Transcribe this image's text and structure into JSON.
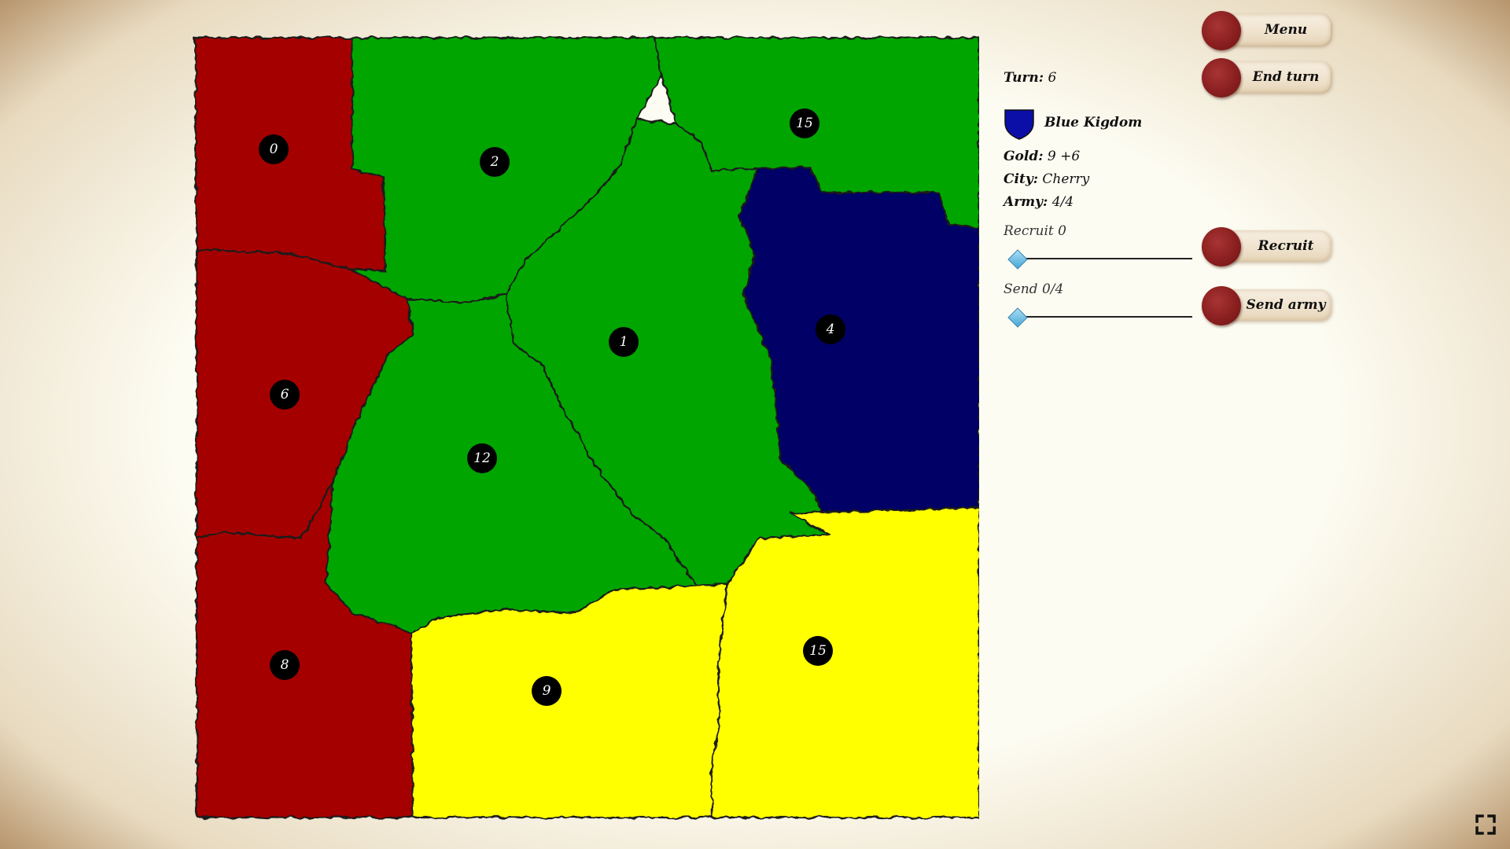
{
  "colors": {
    "red": "#a50000",
    "green": "#00a500",
    "blue": "#000066",
    "yellow": "#ffff00",
    "badge": "#000000",
    "seal": "#8a1f1f",
    "slider_thumb": "#5ab4e0"
  },
  "map": {
    "territories": [
      {
        "id": "t-red-1",
        "owner": "red",
        "army": "0"
      },
      {
        "id": "t-red-2",
        "owner": "red",
        "army": "6"
      },
      {
        "id": "t-red-3",
        "owner": "red",
        "army": "8"
      },
      {
        "id": "t-green-1",
        "owner": "green",
        "army": "2"
      },
      {
        "id": "t-green-2",
        "owner": "green",
        "army": "15"
      },
      {
        "id": "t-green-3",
        "owner": "green",
        "army": "1"
      },
      {
        "id": "t-green-4",
        "owner": "green",
        "army": "12"
      },
      {
        "id": "t-blue-1",
        "owner": "blue",
        "army": "4"
      },
      {
        "id": "t-yellow-1",
        "owner": "yellow",
        "army": "9"
      },
      {
        "id": "t-yellow-2",
        "owner": "yellow",
        "army": "15"
      }
    ]
  },
  "panel": {
    "turn_label": "Turn:",
    "turn_value": "6",
    "kingdom_name": "Blue Kigdom",
    "kingdom_icon": "shield-icon",
    "gold_label": "Gold:",
    "gold_value": "9 +6",
    "city_label": "City:",
    "city_value": "Cherry",
    "army_label": "Army:",
    "army_value": "4/4",
    "recruit_label": "Recruit 0",
    "recruit_level": 0,
    "send_label": "Send 0/4",
    "send_level": 0
  },
  "buttons": {
    "menu": "Menu",
    "end_turn": "End turn",
    "recruit": "Recruit",
    "send_army": "Send army"
  },
  "fullscreen_icon": "fullscreen-icon"
}
